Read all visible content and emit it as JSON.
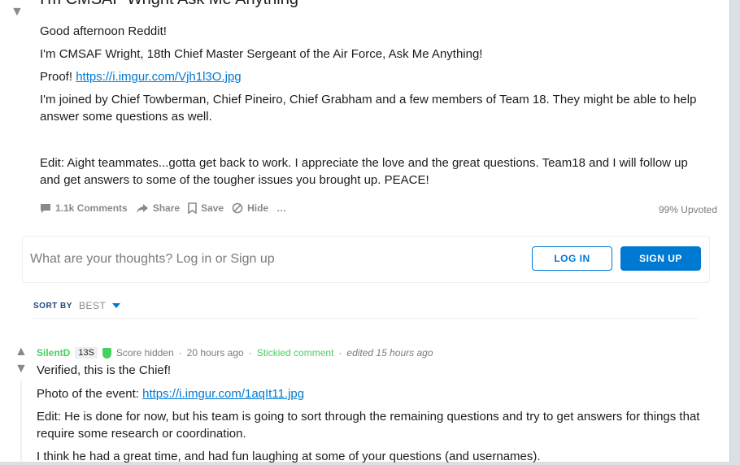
{
  "post": {
    "title": "I'm CMSAF Wright Ask Me Anything",
    "body": {
      "line1": "Good afternoon Reddit!",
      "line2": "I'm CMSAF Wright, 18th Chief Master Sergeant of the Air Force, Ask Me Anything!",
      "proof_label": "Proof!",
      "proof_link": "https://i.imgur.com/Vjh1l3O.jpg",
      "line4": "I'm joined by Chief Towberman, Chief Pineiro, Chief Grabham and a few members of Team 18. They might be able to help answer some questions as well.",
      "edit": "Edit: Aight teammates...gotta get back to work. I appreciate the love and the great questions. Team18 and I will follow up and get answers to some of the tougher issues you brought up. PEACE!"
    },
    "actions": {
      "comments": "1.1k Comments",
      "share": "Share",
      "save": "Save",
      "hide": "Hide",
      "more": "…"
    },
    "upvoted": "99% Upvoted"
  },
  "comment_box": {
    "placeholder": "What are your thoughts? Log in or Sign up",
    "login": "LOG IN",
    "signup": "SIGN UP"
  },
  "sort": {
    "label": "SORT BY",
    "value": "BEST"
  },
  "comment": {
    "user": "SilentD",
    "flair": "13S",
    "score": "Score hidden",
    "time": "20 hours ago",
    "stickied": "Stickied comment",
    "edited": "edited 15 hours ago",
    "line1": "Verified, this is the Chief!",
    "photo_label": "Photo of the event:",
    "photo_link": "https://i.imgur.com/1aqIt11.jpg",
    "line3": "Edit: He is done for now, but his team is going to sort through the remaining questions and try to get answers for things that require some research or coordination.",
    "line4": "I think he had a great time, and had fun laughing at some of your questions (and usernames)."
  },
  "colors": {
    "accent": "#0079d3",
    "mod_green": "#46d160"
  }
}
